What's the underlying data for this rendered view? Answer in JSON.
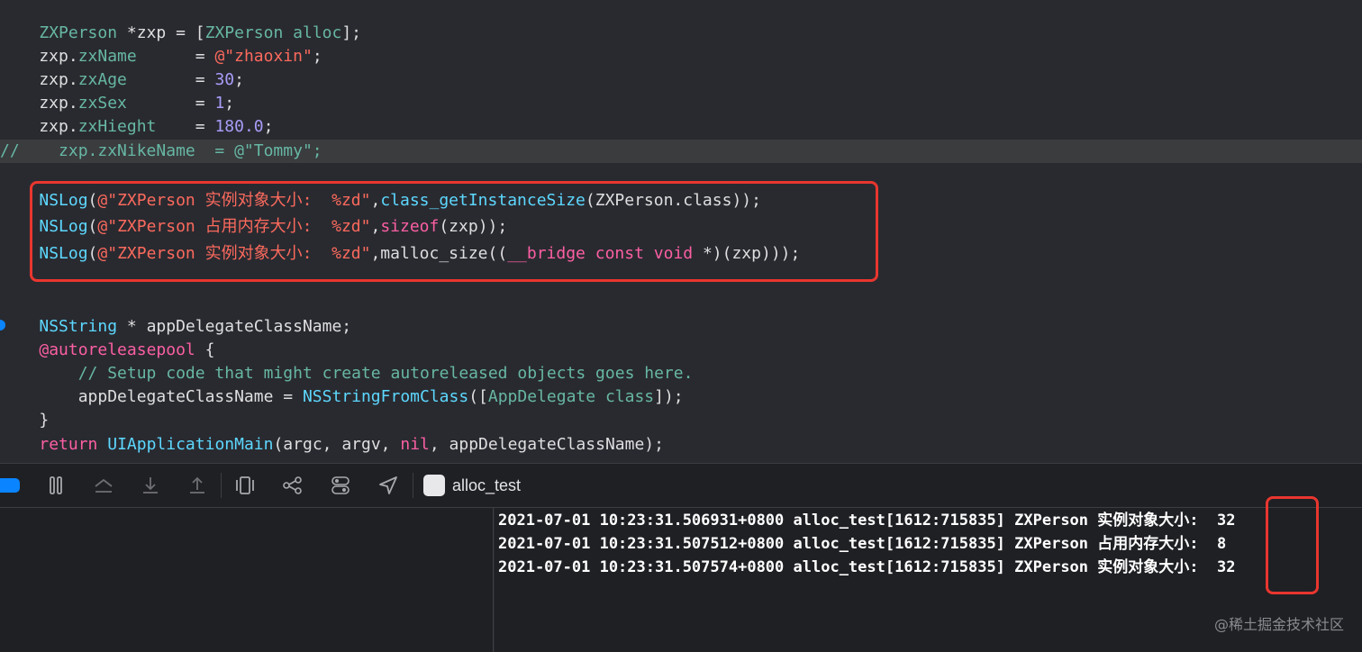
{
  "code_lines": [
    {
      "tokens": [
        [
          "    ",
          "t-white"
        ],
        [
          "ZXPerson",
          "t-green"
        ],
        [
          " *zxp = [",
          "t-white"
        ],
        [
          "ZXPerson",
          "t-green"
        ],
        [
          " ",
          "t-white"
        ],
        [
          "alloc",
          "t-func"
        ],
        [
          "];",
          "t-white"
        ]
      ]
    },
    {
      "tokens": [
        [
          "    zxp.",
          "t-white"
        ],
        [
          "zxName",
          "t-prop"
        ],
        [
          "      = ",
          "t-white"
        ],
        [
          "@\"zhaoxin\"",
          "t-str"
        ],
        [
          ";",
          "t-white"
        ]
      ]
    },
    {
      "tokens": [
        [
          "    zxp.",
          "t-white"
        ],
        [
          "zxAge",
          "t-prop"
        ],
        [
          "       = ",
          "t-white"
        ],
        [
          "30",
          "t-field"
        ],
        [
          ";",
          "t-white"
        ]
      ]
    },
    {
      "tokens": [
        [
          "    zxp.",
          "t-white"
        ],
        [
          "zxSex",
          "t-prop"
        ],
        [
          "       = ",
          "t-white"
        ],
        [
          "1",
          "t-field"
        ],
        [
          ";",
          "t-white"
        ]
      ]
    },
    {
      "tokens": [
        [
          "    zxp.",
          "t-white"
        ],
        [
          "zxHieght",
          "t-prop"
        ],
        [
          "    = ",
          "t-white"
        ],
        [
          "180.0",
          "t-field"
        ],
        [
          ";",
          "t-white"
        ]
      ]
    },
    {
      "tokens": [
        [
          "//    zxp.zxNikeName  = @\"Tommy\";",
          "t-func"
        ]
      ],
      "highlight": true
    },
    {
      "tokens": [
        [
          "",
          "t-white"
        ]
      ]
    },
    {
      "tokens": [
        [
          "    ",
          "t-white"
        ],
        [
          "NSLog",
          "t-cyan"
        ],
        [
          "(",
          "t-white"
        ],
        [
          "@\"ZXPerson 实例对象大小:  %zd\"",
          "t-str"
        ],
        [
          ",",
          "t-white"
        ],
        [
          "class_getInstanceSize",
          "t-cyan"
        ],
        [
          "(ZXPerson.class));",
          "t-white"
        ]
      ]
    },
    {
      "tokens": [
        [
          "    ",
          "t-white"
        ],
        [
          "NSLog",
          "t-cyan"
        ],
        [
          "(",
          "t-white"
        ],
        [
          "@\"ZXPerson 占用内存大小:  %zd\"",
          "t-str"
        ],
        [
          ",",
          "t-white"
        ],
        [
          "sizeof",
          "t-kw"
        ],
        [
          "(zxp));",
          "t-white"
        ]
      ]
    },
    {
      "tokens": [
        [
          "    ",
          "t-white"
        ],
        [
          "NSLog",
          "t-cyan"
        ],
        [
          "(",
          "t-white"
        ],
        [
          "@\"ZXPerson 实例对象大小:  %zd\"",
          "t-str"
        ],
        [
          ",malloc_size((",
          "t-white"
        ],
        [
          "__bridge",
          "t-kw"
        ],
        [
          " ",
          "t-white"
        ],
        [
          "const",
          "t-kw"
        ],
        [
          " ",
          "t-white"
        ],
        [
          "void",
          "t-kw"
        ],
        [
          " *)(zxp)));",
          "t-white"
        ]
      ]
    },
    {
      "tokens": [
        [
          "",
          "t-white"
        ]
      ]
    },
    {
      "tokens": [
        [
          "",
          "t-white"
        ]
      ]
    },
    {
      "tokens": [
        [
          "    ",
          "t-white"
        ],
        [
          "NSString",
          "t-cyan"
        ],
        [
          " * appDelegateClassName;",
          "t-white"
        ]
      ]
    },
    {
      "tokens": [
        [
          "    ",
          "t-white"
        ],
        [
          "@autoreleasepool",
          "t-kw"
        ],
        [
          " {",
          "t-white"
        ]
      ]
    },
    {
      "tokens": [
        [
          "        // Setup code that might create autoreleased objects goes here.",
          "t-func"
        ]
      ]
    },
    {
      "tokens": [
        [
          "        appDelegateClassName = ",
          "t-white"
        ],
        [
          "NSStringFromClass",
          "t-cyan"
        ],
        [
          "([",
          "t-white"
        ],
        [
          "AppDelegate",
          "t-green"
        ],
        [
          " ",
          "t-white"
        ],
        [
          "class",
          "t-func"
        ],
        [
          "]);",
          "t-white"
        ]
      ]
    },
    {
      "tokens": [
        [
          "    }",
          "t-white"
        ]
      ]
    },
    {
      "tokens": [
        [
          "    ",
          "t-white"
        ],
        [
          "return",
          "t-kw"
        ],
        [
          " ",
          "t-white"
        ],
        [
          "UIApplicationMain",
          "t-cyan"
        ],
        [
          "(argc, argv, ",
          "t-white"
        ],
        [
          "nil",
          "t-kw"
        ],
        [
          ", appDelegateClassName);",
          "t-white"
        ]
      ]
    }
  ],
  "toolbar": {
    "target_name": "alloc_test",
    "icons": [
      "pause-icon",
      "step-over-icon",
      "step-into-icon",
      "step-out-icon",
      "view-hierarchy-icon",
      "memory-graph-icon",
      "environment-overrides-icon",
      "location-icon"
    ]
  },
  "console": {
    "lines": [
      "2021-07-01 10:23:31.506931+0800 alloc_test[1612:715835] ZXPerson 实例对象大小:  32",
      "2021-07-01 10:23:31.507512+0800 alloc_test[1612:715835] ZXPerson 占用内存大小:  8",
      "2021-07-01 10:23:31.507574+0800 alloc_test[1612:715835] ZXPerson 实例对象大小:  32"
    ]
  },
  "watermark": "@稀土掘金技术社区",
  "colors": {
    "highlight_box": "#e8362f",
    "breakpoint_blue": "#0a84ff",
    "editor_bg": "#292a30",
    "console_bg": "#1f2024"
  }
}
